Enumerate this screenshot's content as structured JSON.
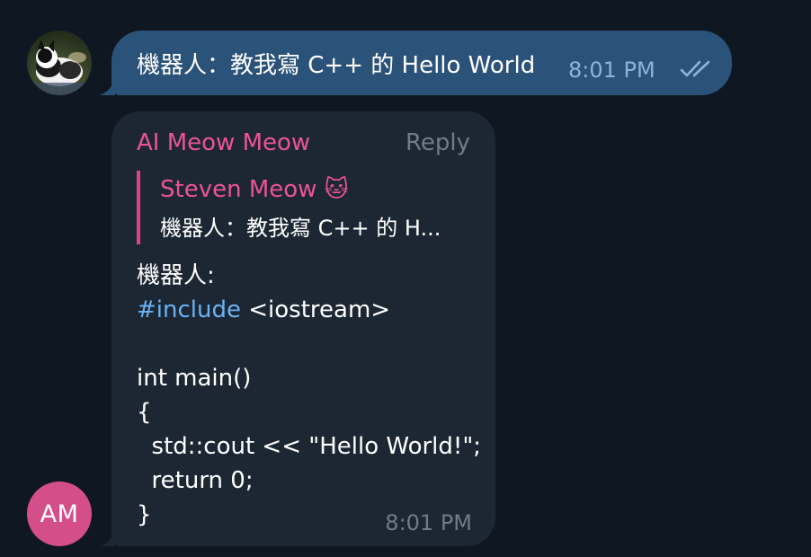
{
  "outgoing": {
    "text": "機器人：教我寫 C++ 的 Hello World",
    "time": "8:01 PM",
    "status_icon": "double-check-icon"
  },
  "incoming": {
    "sender": "AI Meow Meow",
    "reply_label": "Reply",
    "quote": {
      "author": "Steven Meow 🐱",
      "text": "機器人：教我寫 C++ 的 H..."
    },
    "lines": {
      "l1": "機器人:",
      "l2_tag": "#include",
      "l2_rest": " <iostream>",
      "l3": "",
      "l4": "int main()",
      "l5": "{",
      "l6": "  std::cout << \"Hello World!\";",
      "l7": "  return 0;",
      "l8": "}"
    },
    "time": "8:01 PM",
    "avatar_initials": "AM"
  },
  "colors": {
    "background": "#0f1722",
    "outgoing_bubble": "#2b5278",
    "incoming_bubble": "#1c2733",
    "name_accent": "#ec5396",
    "hashtag": "#6ab3f3",
    "avatar_am": "#d44f89"
  }
}
